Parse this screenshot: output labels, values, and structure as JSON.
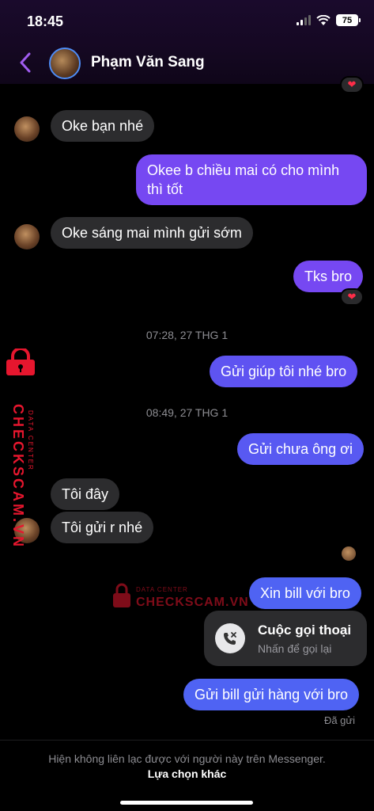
{
  "status_bar": {
    "time": "18:45",
    "battery": "75"
  },
  "header": {
    "contact_name": "Phạm Văn Sang"
  },
  "reaction_icon": "heart",
  "messages": [
    {
      "dir": "in",
      "text": "Oke bạn nhé"
    },
    {
      "dir": "out",
      "text_lines": [
        "Okee b chiều mai có cho mình",
        "thì tốt"
      ]
    },
    {
      "dir": "in",
      "text": "Oke sáng mai mình gửi sớm"
    },
    {
      "dir": "out",
      "text": "Tks bro"
    },
    {
      "type": "timestamp",
      "text": "07:28, 27 THG 1"
    },
    {
      "dir": "out",
      "text": "Gửi giúp tôi nhé bro"
    },
    {
      "type": "timestamp",
      "text": "08:49, 27 THG 1"
    },
    {
      "dir": "out",
      "text": "Gửi chưa ông ơi"
    },
    {
      "dir": "in",
      "text": "Tôi đây"
    },
    {
      "dir": "in",
      "text": "Tôi gửi r nhé"
    },
    {
      "dir": "out",
      "text": "Xin bill với bro"
    },
    {
      "dir": "out",
      "text": "Gửi bill gửi hàng với bro"
    }
  ],
  "call_card": {
    "title": "Cuộc gọi thoại",
    "subtitle": "Nhấn để gọi lại",
    "icon": "missed-call-icon"
  },
  "delivery_status": "Đã gửi",
  "watermark": {
    "brand": "CHECKSCAM.VN",
    "tagline": "DATA CENTER"
  },
  "footer": {
    "message": "Hiện không liên lạc được với người này trên Messenger.",
    "link": "Lựa chọn khác"
  },
  "colors": {
    "accent": "#a05cf0",
    "bubble_out_purple": "#7648f2",
    "bubble_out_blue": "#4f63f3",
    "bubble_in": "#2c2c2e",
    "watermark_red": "#e6162e"
  }
}
